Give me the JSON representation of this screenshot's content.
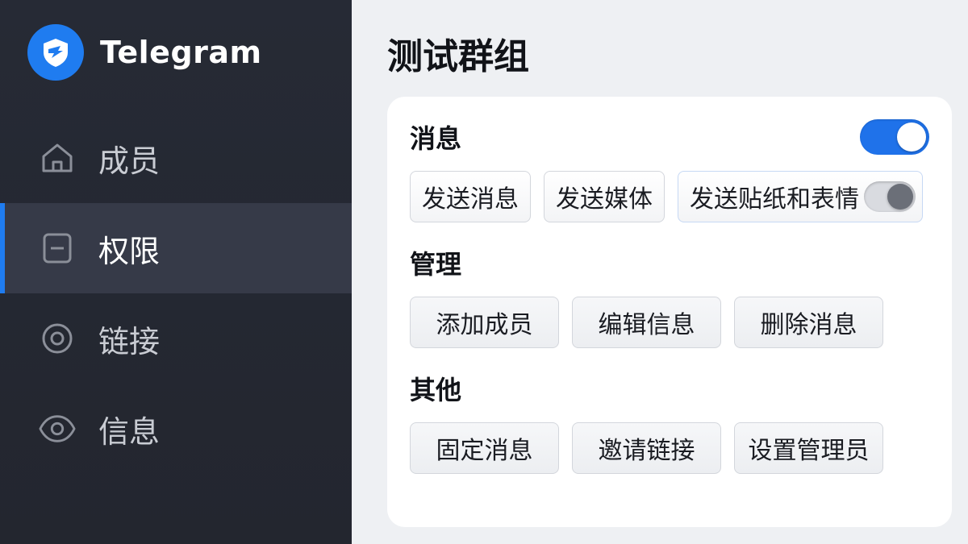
{
  "brand": {
    "name": "Telegram",
    "logo_icon": "shield-logo-icon",
    "accent": "#1f7cf0"
  },
  "sidebar": {
    "items": [
      {
        "label": "成员",
        "icon": "home-icon",
        "active": false
      },
      {
        "label": "权限",
        "icon": "minus-square-icon",
        "active": true
      },
      {
        "label": "链接",
        "icon": "target-icon",
        "active": false
      },
      {
        "label": "信息",
        "icon": "eye-icon",
        "active": false
      }
    ]
  },
  "page": {
    "title": "测试群组"
  },
  "sections": {
    "messages": {
      "title": "消息",
      "enabled": true,
      "chips": [
        "发送消息",
        "发送媒体"
      ],
      "sticker_chip": {
        "label": "发送贴纸和表情",
        "enabled": false
      }
    },
    "manage": {
      "title": "管理",
      "chips": [
        "添加成员",
        "编辑信息",
        "删除消息"
      ]
    },
    "other": {
      "title": "其他",
      "chips": [
        "固定消息",
        "邀请链接",
        "设置管理员"
      ]
    }
  }
}
